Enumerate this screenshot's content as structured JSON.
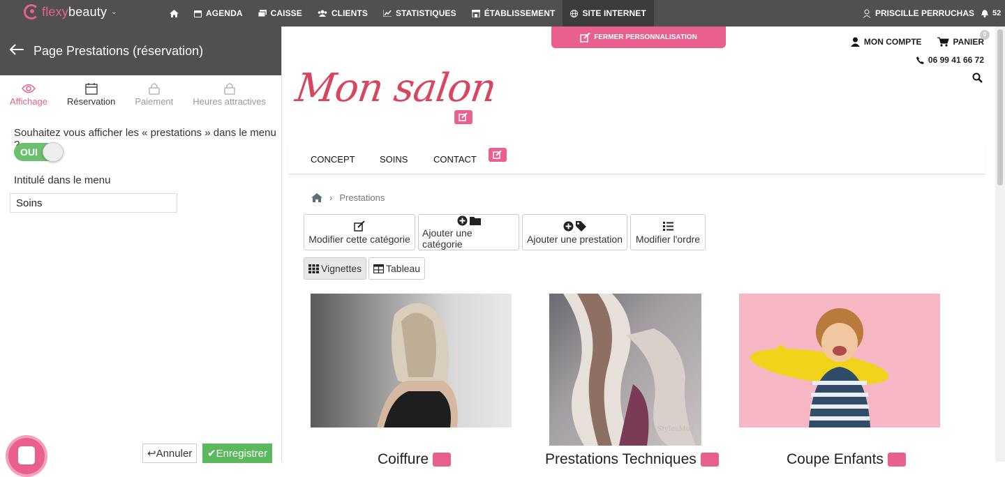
{
  "topbar": {
    "logo_flexy": "flexy",
    "logo_beauty": "beauty",
    "nav": [
      {
        "icon": "home-icon",
        "label": ""
      },
      {
        "icon": "calendar-icon",
        "label": "AGENDA"
      },
      {
        "icon": "cash-icon",
        "label": "CAISSE"
      },
      {
        "icon": "users-icon",
        "label": "CLIENTS"
      },
      {
        "icon": "chart-icon",
        "label": "STATISTIQUES"
      },
      {
        "icon": "store-icon",
        "label": "ÉTABLISSEMENT"
      },
      {
        "icon": "globe-icon",
        "label": "SITE INTERNET"
      }
    ],
    "user_name": "PRISCILLE PERRUCHAS",
    "notif_count": "52"
  },
  "left_panel": {
    "title": "Page Prestations (réservation)",
    "tabs": [
      {
        "label": "Affichage",
        "state": "active"
      },
      {
        "label": "Réservation",
        "state": "normal"
      },
      {
        "label": "Paiement",
        "state": "locked"
      },
      {
        "label": "Heures attractives",
        "state": "locked"
      }
    ],
    "question": "Souhaitez vous afficher les « prestations » dans le menu ?",
    "toggle_label": "OUI",
    "menu_label": "Intitulé dans le menu",
    "menu_value": "Soins",
    "cancel_label": "Annuler",
    "save_label": "Enregistrer"
  },
  "preview": {
    "close_custom": "FERMER PERSONNALISATION",
    "account": "MON COMPTE",
    "cart": "PANIER",
    "cart_count": "0",
    "phone": "06 99 41 66 72",
    "salon_name": "Mon salon",
    "menu": [
      "CONCEPT",
      "SOINS",
      "CONTACT"
    ],
    "breadcrumb_current": "Prestations",
    "actions": [
      {
        "label": "Modifier cette catégorie"
      },
      {
        "label": "Ajouter une catégorie"
      },
      {
        "label": "Ajouter une prestation"
      },
      {
        "label": "Modifier l'ordre"
      }
    ],
    "views": [
      "Vignettes",
      "Tableau"
    ],
    "cards": [
      {
        "title": "Coiffure"
      },
      {
        "title": "Prestations Techniques"
      },
      {
        "title": "Coupe Enfants"
      }
    ],
    "watermark": "StylesMod"
  },
  "colors": {
    "brand_pink": "#e9608f",
    "topbar": "#505050",
    "save_green": "#5cb85c"
  }
}
